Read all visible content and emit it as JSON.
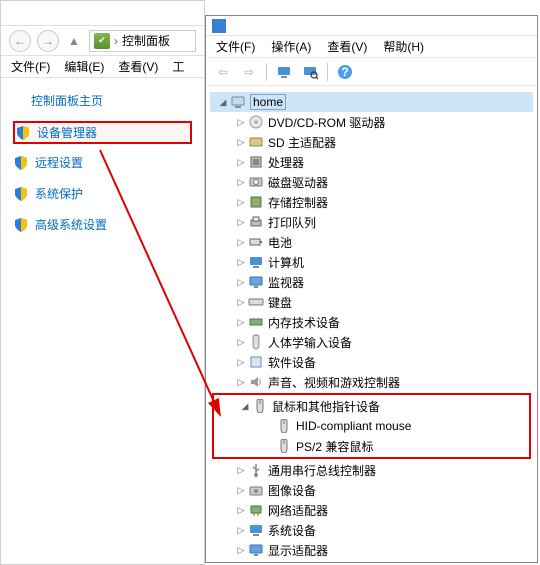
{
  "left": {
    "addr_text": "控制面板",
    "menu": {
      "file": "文件(F)",
      "edit": "编辑(E)",
      "view": "查看(V)",
      "tools": "工"
    },
    "cp_home": "控制面板主页",
    "items": [
      {
        "label": "设备管理器",
        "hl": true
      },
      {
        "label": "远程设置",
        "hl": false
      },
      {
        "label": "系统保护",
        "hl": false
      },
      {
        "label": "高级系统设置",
        "hl": false
      }
    ]
  },
  "right": {
    "menu": {
      "file": "文件(F)",
      "action": "操作(A)",
      "view": "查看(V)",
      "help": "帮助(H)"
    },
    "root": "home",
    "nodes": [
      {
        "label": "DVD/CD-ROM 驱动器",
        "icon": "disc"
      },
      {
        "label": "SD 主适配器",
        "icon": "card"
      },
      {
        "label": "处理器",
        "icon": "cpu"
      },
      {
        "label": "磁盘驱动器",
        "icon": "disk"
      },
      {
        "label": "存储控制器",
        "icon": "storage"
      },
      {
        "label": "打印队列",
        "icon": "printer"
      },
      {
        "label": "电池",
        "icon": "battery"
      },
      {
        "label": "计算机",
        "icon": "computer"
      },
      {
        "label": "监视器",
        "icon": "monitor"
      },
      {
        "label": "键盘",
        "icon": "keyboard"
      },
      {
        "label": "内存技术设备",
        "icon": "memory"
      },
      {
        "label": "人体学输入设备",
        "icon": "hid"
      },
      {
        "label": "软件设备",
        "icon": "software"
      },
      {
        "label": "声音、视频和游戏控制器",
        "icon": "audio"
      }
    ],
    "mouse_cat": "鼠标和其他指针设备",
    "mouse_children": [
      {
        "label": "HID-compliant mouse"
      },
      {
        "label": "PS/2 兼容鼠标"
      }
    ],
    "nodes2": [
      {
        "label": "通用串行总线控制器",
        "icon": "usb"
      },
      {
        "label": "图像设备",
        "icon": "imaging"
      },
      {
        "label": "网络适配器",
        "icon": "network"
      },
      {
        "label": "系统设备",
        "icon": "system"
      },
      {
        "label": "显示适配器",
        "icon": "display"
      }
    ]
  }
}
